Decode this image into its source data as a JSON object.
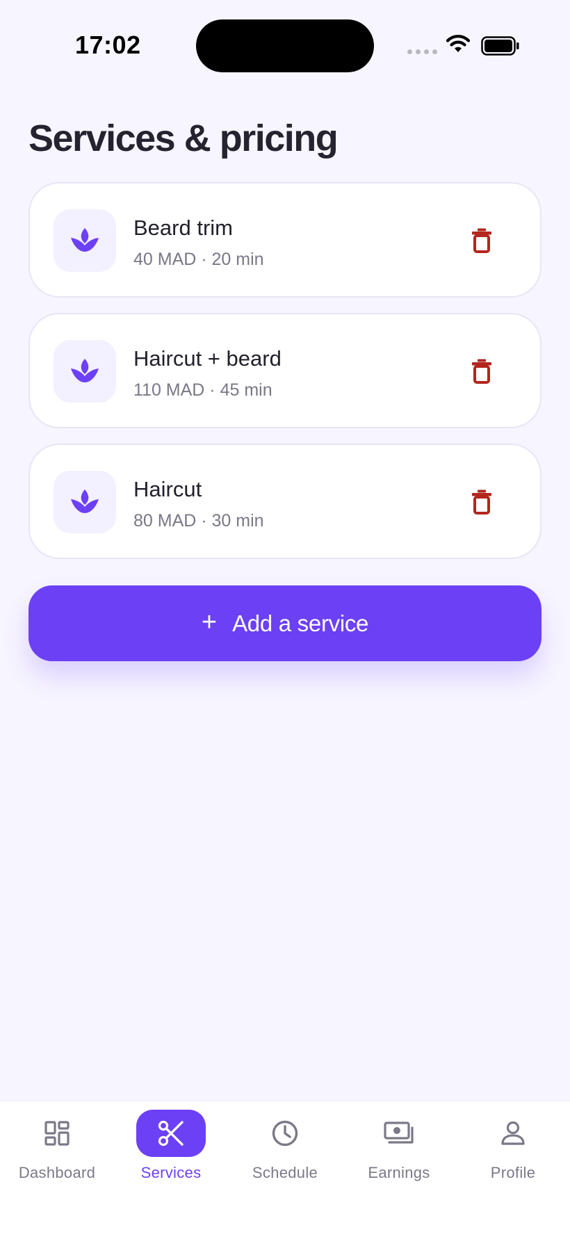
{
  "status_bar": {
    "time": "17:02"
  },
  "page": {
    "title": "Services & pricing"
  },
  "services": [
    {
      "name": "Beard trim",
      "meta": "40 MAD · 20 min",
      "icon": "lotus-icon",
      "action_icon": "trash-icon"
    },
    {
      "name": "Haircut + beard",
      "meta": "110 MAD · 45 min",
      "icon": "lotus-icon",
      "action_icon": "trash-icon"
    },
    {
      "name": "Haircut",
      "meta": "80 MAD · 30 min",
      "icon": "lotus-icon",
      "action_icon": "trash-icon"
    }
  ],
  "add_button": {
    "icon": "+",
    "label": "Add a service"
  },
  "nav": {
    "active": "Services",
    "items": [
      {
        "label": "Dashboard",
        "icon": "dashboard-grid-icon"
      },
      {
        "label": "Services",
        "icon": "scissors-icon"
      },
      {
        "label": "Schedule",
        "icon": "clock-icon"
      },
      {
        "label": "Earnings",
        "icon": "cash-icon"
      },
      {
        "label": "Profile",
        "icon": "person-icon"
      }
    ]
  },
  "colors": {
    "accent": "#6C40F5",
    "background": "#F7F5FF",
    "danger": "#B3261E",
    "muted_text": "#7A7787"
  }
}
